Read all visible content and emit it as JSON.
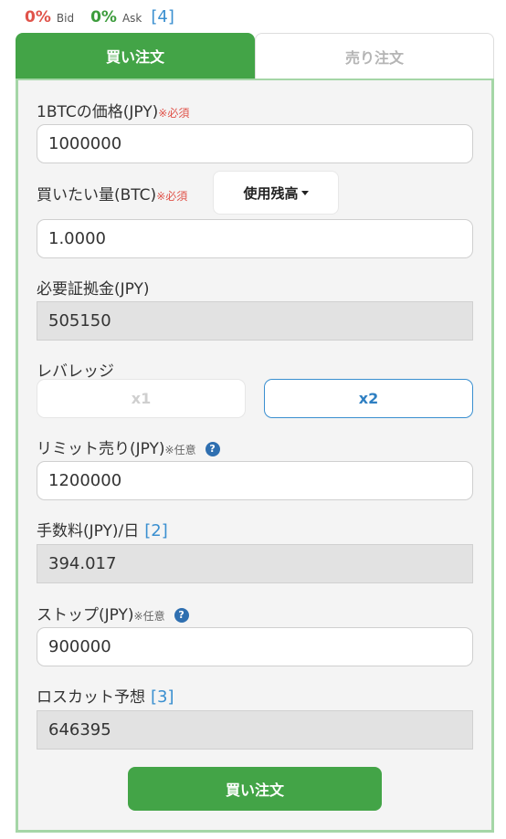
{
  "ticker": {
    "bid_pct": "0%",
    "bid_label": "Bid",
    "ask_pct": "0%",
    "ask_label": "Ask",
    "ref": "[4]"
  },
  "tabs": [
    {
      "label": "買い注文",
      "active": true
    },
    {
      "label": "売り注文",
      "active": false
    }
  ],
  "form": {
    "price": {
      "label": "1BTCの価格(JPY)",
      "required": "※必須",
      "value": "1000000"
    },
    "amount": {
      "label": "買いたい量(BTC)",
      "required": "※必須",
      "balance_button": "使用残高",
      "value": "1.0000"
    },
    "margin": {
      "label": "必要証拠金(JPY)",
      "value": "505150"
    },
    "leverage": {
      "label": "レバレッジ",
      "options": [
        "x1",
        "x2"
      ],
      "selected": "x2"
    },
    "limit": {
      "label": "リミット売り(JPY)",
      "optional": "※任意",
      "value": "1200000"
    },
    "fee": {
      "label": "手数料(JPY)/日",
      "ref": "[2]",
      "value": "394.017"
    },
    "stop": {
      "label": "ストップ(JPY)",
      "optional": "※任意",
      "value": "900000"
    },
    "losscut": {
      "label": "ロスカット予想",
      "ref": "[3]",
      "value": "646395"
    }
  },
  "submit_label": "買い注文",
  "colors": {
    "accent_green": "#43a447",
    "panel_border": "#a5d6a7",
    "required_red": "#e0534a",
    "link_blue": "#3a8fd0"
  },
  "icons": {
    "help": "question-circle-icon",
    "caret": "caret-down-icon"
  }
}
